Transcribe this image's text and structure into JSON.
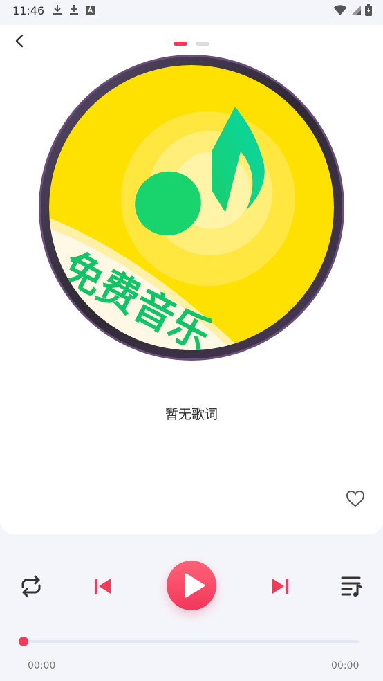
{
  "status_bar": {
    "time": "11:46",
    "left_icons": [
      "download-icon",
      "download-icon",
      "text-a-icon"
    ],
    "right_icons": [
      "wifi-icon",
      "signal-icon",
      "battery-icon"
    ]
  },
  "player": {
    "pager": {
      "count": 2,
      "active_index": 0
    },
    "album_art": {
      "text": "免费音乐",
      "icon": "music-note-icon"
    },
    "lyrics": "暂无歌词",
    "current_time": "00:00",
    "total_time": "00:00",
    "progress": 0
  },
  "controls": {
    "repeat_icon": "repeat-icon",
    "prev_icon": "skip-previous-icon",
    "play_icon": "play-icon",
    "next_icon": "skip-next-icon",
    "playlist_icon": "playlist-icon"
  },
  "colors": {
    "accent": "#f23a5b",
    "disc_yellow": "#ffe100",
    "note_green": "#1ed36f",
    "background": "#f4f5fa"
  }
}
